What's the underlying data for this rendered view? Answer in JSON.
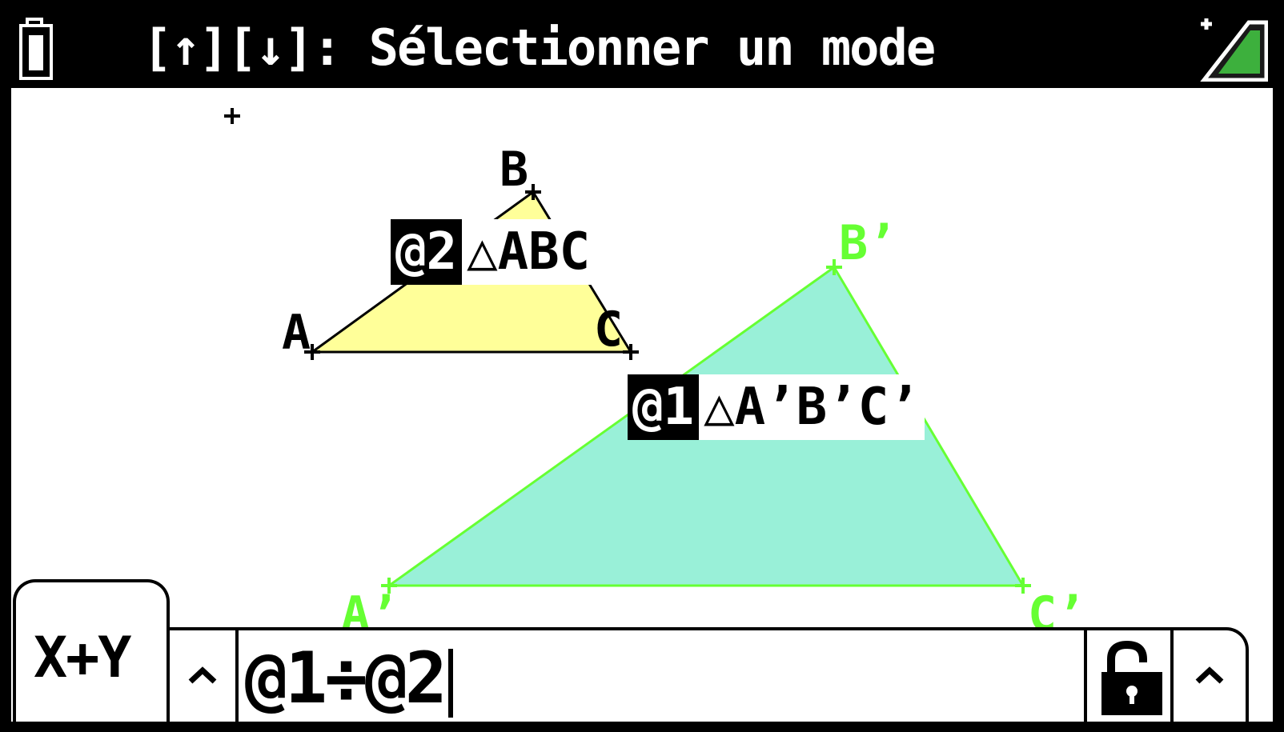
{
  "status_bar": {
    "message": "[↑][↓]: Sélectionner un mode",
    "battery_icon": "battery-icon",
    "signal_icon": "signal-strength-icon"
  },
  "geometry": {
    "triangle_abc": {
      "points": {
        "a": "A",
        "b": "B",
        "c": "C"
      },
      "fill": "#ffff99"
    },
    "triangle_abc_prime": {
      "points": {
        "a": "A’",
        "b": "B’",
        "c": "C’"
      },
      "fill": "#99f0d8",
      "stroke": "#66ff33"
    },
    "measure_2": {
      "tag": "@2",
      "value": "△ABC"
    },
    "measure_1": {
      "tag": "@1",
      "value": "△A’B’C’"
    }
  },
  "bottom_bar": {
    "tab_label": "X+Y",
    "formula": "@1÷@2",
    "chevron_left_icon": "chevron-up-icon",
    "lock_icon": "unlock-icon",
    "chevron_right_icon": "chevron-up-icon"
  }
}
